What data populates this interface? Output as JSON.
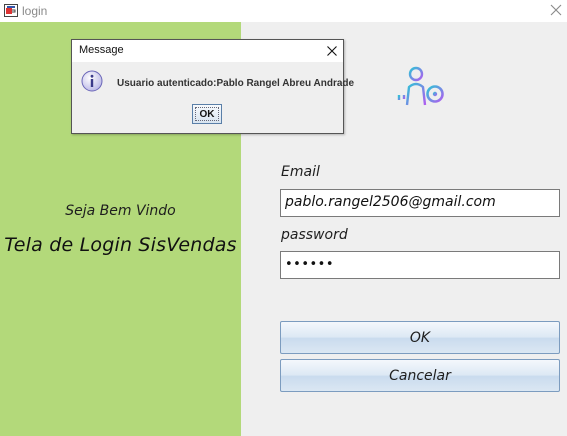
{
  "window": {
    "title": "login",
    "close_glyph": "✕",
    "icon": "coffee-cup-icon"
  },
  "left_panel": {
    "welcome": "Seja Bem Vindo",
    "title": "Tela de Login SisVendas",
    "background": "#b3d97a"
  },
  "right_panel": {
    "icon": "user-key-icon",
    "email_label": "Email",
    "email_value": "pablo.rangel2506@gmail.com",
    "password_label": "password",
    "password_value": "••••••",
    "ok_button": "OK",
    "cancel_button": "Cancelar"
  },
  "dialog": {
    "title": "Message",
    "message": "Usuario autenticado:Pablo Rangel Abreu Andrade",
    "ok_button": "OK",
    "icon": "info-icon"
  },
  "colors": {
    "accent_gradient_start": "#2ec4d6",
    "accent_gradient_end": "#b05cf0"
  }
}
